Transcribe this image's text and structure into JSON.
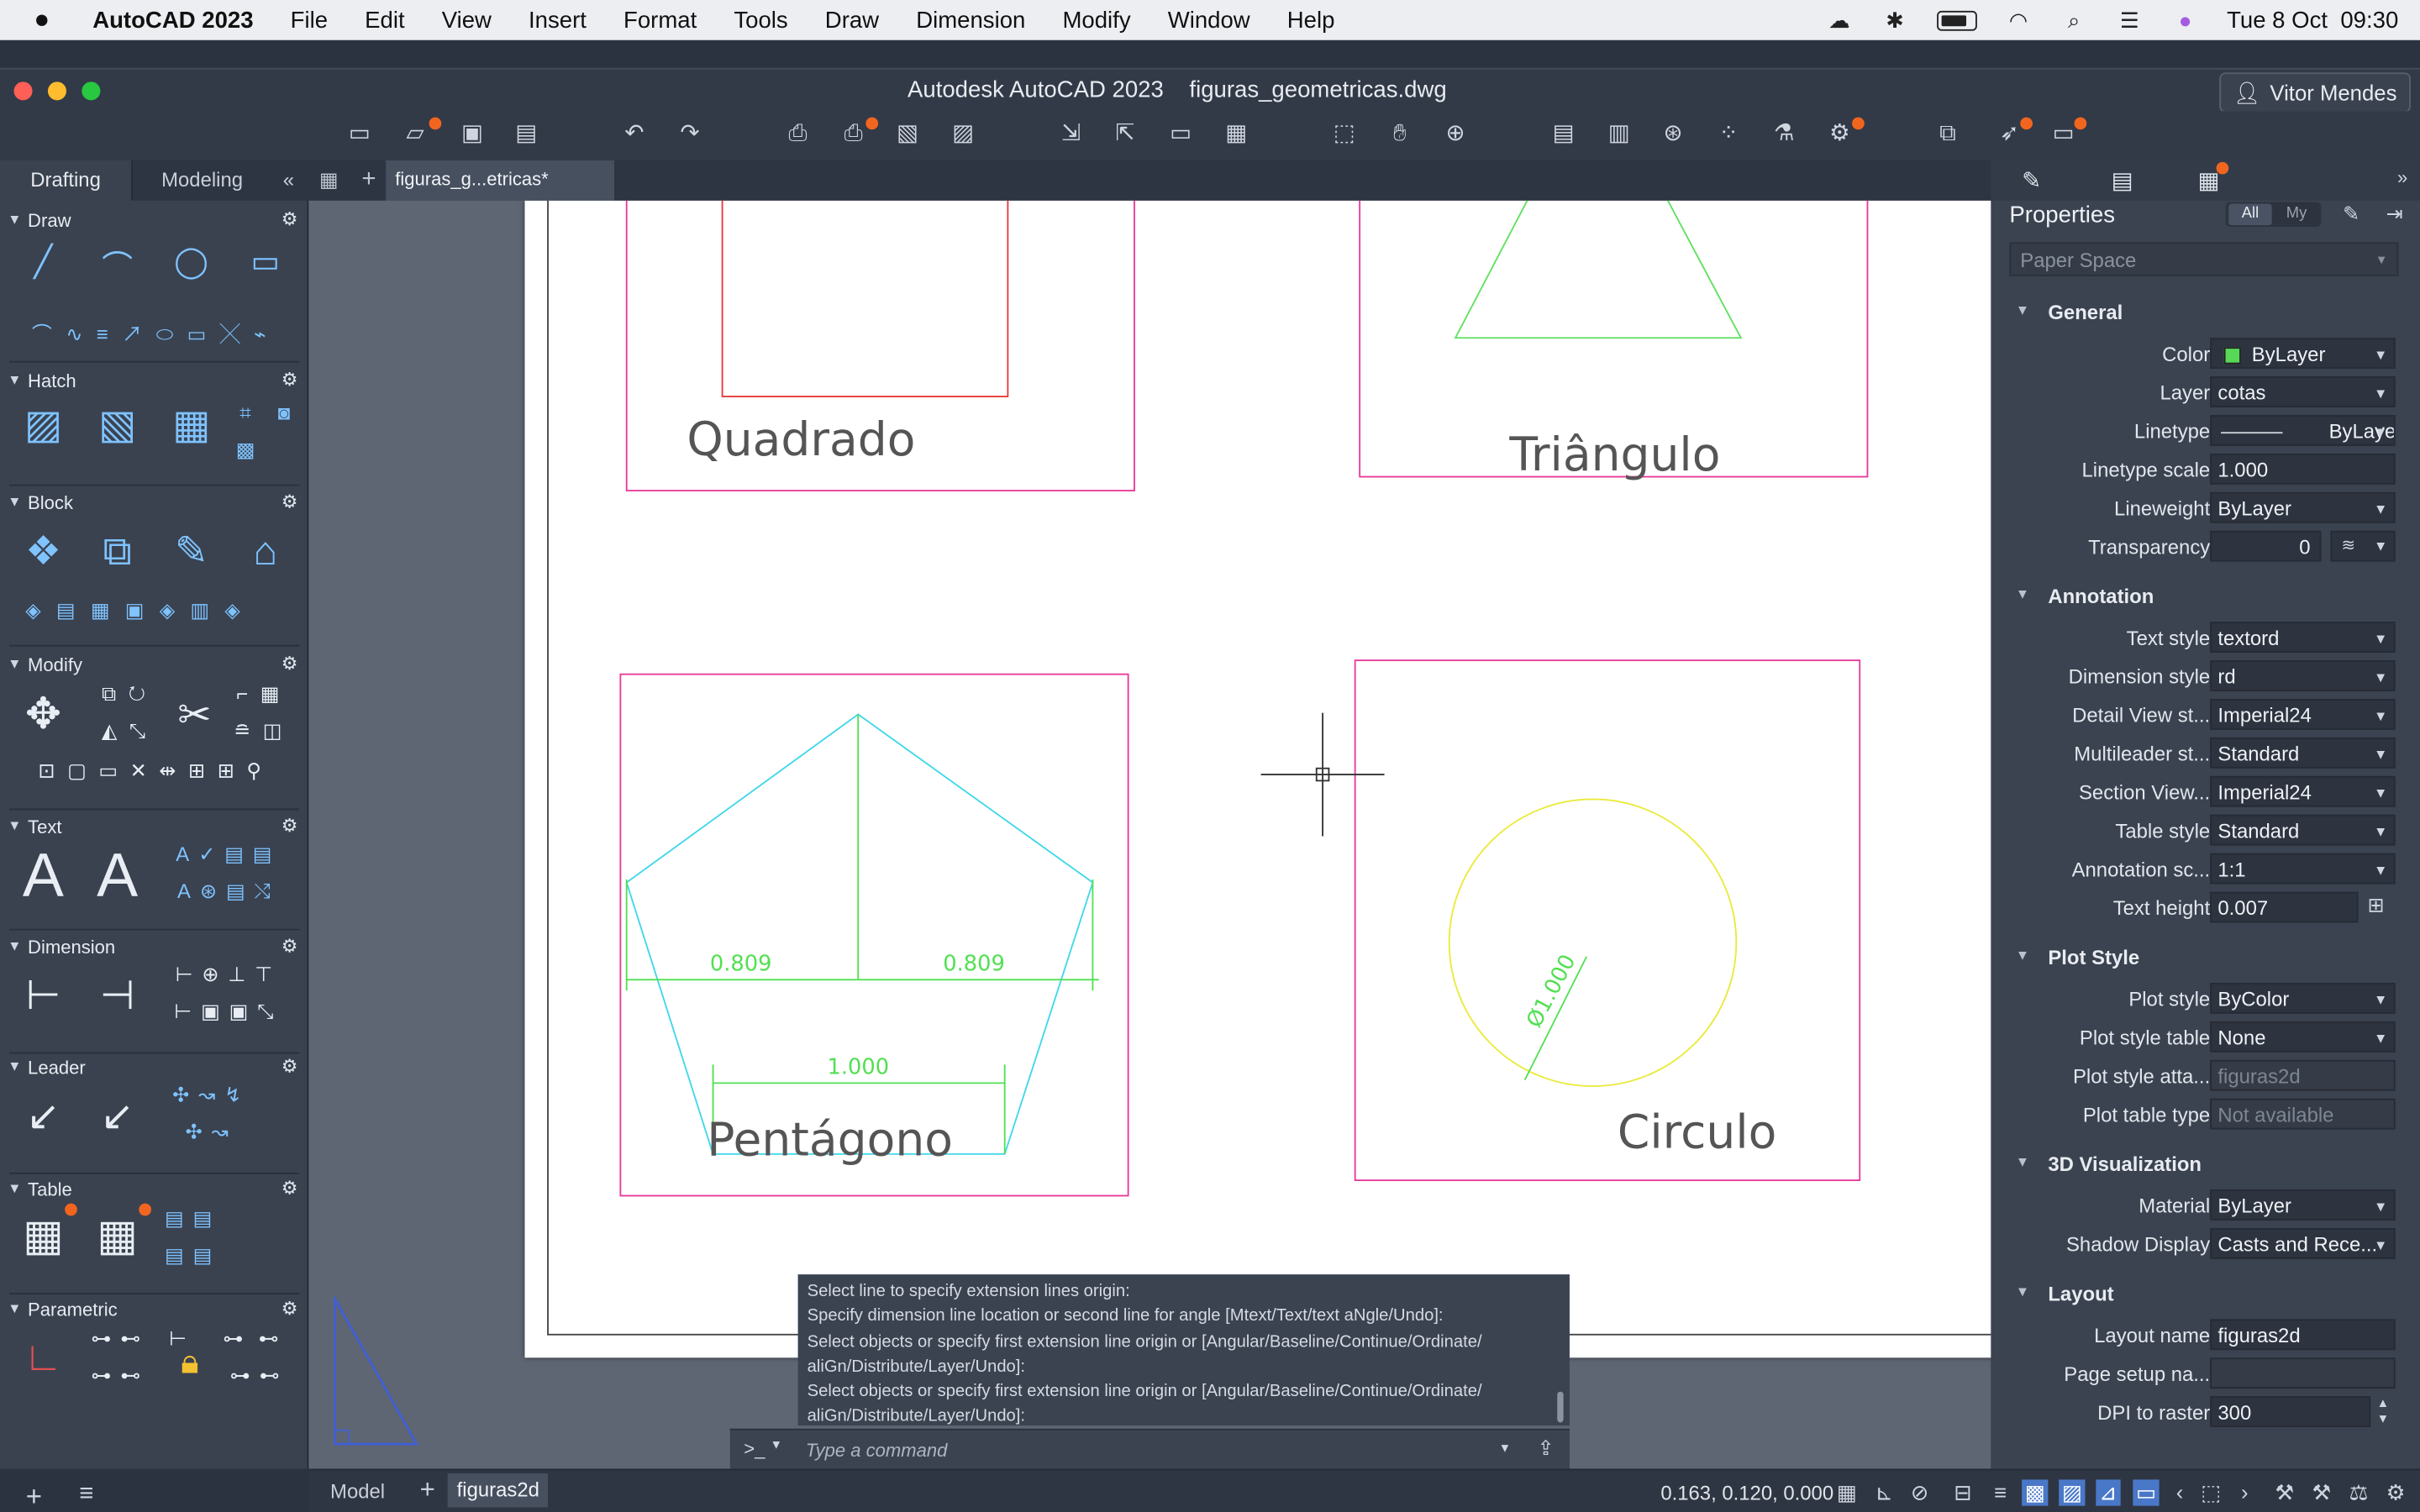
{
  "menubar": {
    "app_name": "AutoCAD 2023",
    "menus": [
      "File",
      "Edit",
      "View",
      "Insert",
      "Format",
      "Tools",
      "Draw",
      "Dimension",
      "Modify",
      "Window",
      "Help"
    ],
    "datetime": "Tue 8 Oct  09:30"
  },
  "window": {
    "title": "Autodesk AutoCAD 2023    figuras_geometricas.dwg",
    "user": "Vitor Mendes"
  },
  "workspace_tabs": {
    "drafting": "Drafting",
    "modeling": "Modeling"
  },
  "file_tab": "figuras_g...etricas*",
  "palette_sections": {
    "draw": "Draw",
    "hatch": "Hatch",
    "block": "Block",
    "modify": "Modify",
    "text": "Text",
    "dimension": "Dimension",
    "leader": "Leader",
    "table": "Table",
    "parametric": "Parametric"
  },
  "drawing": {
    "labels": {
      "square": "Quadrado",
      "triangle": "Triângulo",
      "pentagon": "Pentágono",
      "circle": "Circulo"
    },
    "dimensions": {
      "left": "0.809",
      "right": "0.809",
      "bottom": "1.000",
      "diameter": "Ø1.000"
    },
    "colors": {
      "frame": "#e8399a",
      "square": "#e83838",
      "triangle": "#5fe05f",
      "pentagon": "#3fd7ea",
      "dims": "#52e052",
      "circle": "#eaea3a",
      "label": "#555555"
    }
  },
  "command_line": {
    "history": [
      "Select line to specify extension lines origin:",
      "Specify dimension line location or second line for angle [Mtext/Text/text aNgle/Undo]:",
      "Select objects or specify first extension line origin or [Angular/Baseline/Continue/Ordinate/",
      "aliGn/Distribute/Layer/Undo]:",
      "Select objects or specify first extension line origin or [Angular/Baseline/Continue/Ordinate/",
      "aliGn/Distribute/Layer/Undo]:"
    ],
    "prompt": ">_",
    "placeholder": "Type a command"
  },
  "properties": {
    "title": "Properties",
    "filter_all": "All",
    "filter_my": "My",
    "selection": "Paper Space",
    "groups": {
      "general": "General",
      "annotation": "Annotation",
      "plot_style": "Plot Style",
      "visualization": "3D Visualization",
      "layout": "Layout"
    },
    "general": {
      "color_label": "Color",
      "color_value": "ByLayer",
      "layer_label": "Layer",
      "layer_value": "cotas",
      "linetype_label": "Linetype",
      "linetype_value": "ByLayer",
      "linetype_scale_label": "Linetype scale",
      "linetype_scale_value": "1.000",
      "lineweight_label": "Lineweight",
      "lineweight_value": "ByLayer",
      "transparency_label": "Transparency",
      "transparency_value": "0"
    },
    "annotation": {
      "text_style_label": "Text style",
      "text_style_value": "textord",
      "dim_style_label": "Dimension style",
      "dim_style_value": "rd",
      "detail_view_label": "Detail View st...",
      "detail_view_value": "Imperial24",
      "multileader_label": "Multileader st...",
      "multileader_value": "Standard",
      "section_view_label": "Section View...",
      "section_view_value": "Imperial24",
      "table_style_label": "Table style",
      "table_style_value": "Standard",
      "anno_scale_label": "Annotation sc...",
      "anno_scale_value": "1:1",
      "text_height_label": "Text height",
      "text_height_value": "0.007"
    },
    "plot_style": {
      "plot_style_label": "Plot style",
      "plot_style_value": "ByColor",
      "plot_table_label": "Plot style table",
      "plot_table_value": "None",
      "plot_attach_label": "Plot style atta...",
      "plot_attach_value": "figuras2d",
      "plot_type_label": "Plot table type",
      "plot_type_value": "Not available"
    },
    "visualization": {
      "material_label": "Material",
      "material_value": "ByLayer",
      "shadow_label": "Shadow Display",
      "shadow_value": "Casts and Rece..."
    },
    "layout": {
      "layout_name_label": "Layout name",
      "layout_name_value": "figuras2d",
      "page_setup_label": "Page setup na...",
      "page_setup_value": "",
      "dpi_label": "DPI to raster",
      "dpi_value": "300"
    }
  },
  "status_bar": {
    "model_tab": "Model",
    "layout_tab": "figuras2d",
    "coordinates": "0.163, 0.120, 0.000"
  }
}
